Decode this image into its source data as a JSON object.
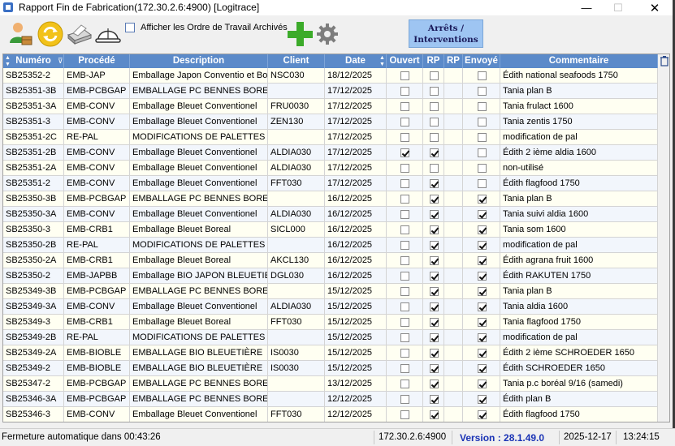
{
  "window": {
    "title": "Rapport Fin de Fabrication(172.30.2.6:4900) [Logitrace]",
    "minimize": "—",
    "maximize": "☐",
    "close": "✕"
  },
  "toolbar": {
    "icons": [
      "user-box-icon",
      "refresh-icon",
      "printer-icon",
      "hard-hat-icon",
      "add-plus-icon",
      "gear-icon"
    ],
    "archive_label": "Afficher les Ordre de Travail Archivés",
    "archive_checked": false,
    "arrets_line1": "Arrêts /",
    "arrets_line2": "Interventions"
  },
  "grid": {
    "headers": {
      "numero": "Numéro",
      "procede": "Procédé",
      "description": "Description",
      "client": "Client",
      "date": "Date",
      "ouvert": "Ouvert",
      "rp": "RP",
      "rp2": "RP",
      "envoye": "Envoyé",
      "commentaire": "Commentaire"
    },
    "rows": [
      {
        "numero": "SB25352-2",
        "procede": "EMB-JAP",
        "description": "Emballage Japon Conventio et Boré",
        "client": "NSC030",
        "date": "18/12/2025",
        "ouvert": false,
        "rp": false,
        "envoye": false,
        "commentaire": "Édith  national seafoods   1750"
      },
      {
        "numero": "SB25351-3B",
        "procede": "EMB-PCBGAP",
        "description": "EMBALLAGE PC BENNES BOREA",
        "client": "",
        "date": "17/12/2025",
        "ouvert": false,
        "rp": false,
        "envoye": false,
        "commentaire": "Tania  plan B"
      },
      {
        "numero": "SB25351-3A",
        "procede": "EMB-CONV",
        "description": "Emballage Bleuet Conventionel",
        "client": "FRU0030",
        "date": "17/12/2025",
        "ouvert": false,
        "rp": false,
        "envoye": false,
        "commentaire": "Tania frulact 1600"
      },
      {
        "numero": "SB25351-3",
        "procede": "EMB-CONV",
        "description": "Emballage Bleuet Conventionel",
        "client": "ZEN130",
        "date": "17/12/2025",
        "ouvert": false,
        "rp": false,
        "envoye": false,
        "commentaire": "Tania  zentis 1750"
      },
      {
        "numero": "SB25351-2C",
        "procede": "RE-PAL",
        "description": "MODIFICATIONS DE PALETTES",
        "client": "",
        "date": "17/12/2025",
        "ouvert": false,
        "rp": false,
        "envoye": false,
        "commentaire": "modification de pal"
      },
      {
        "numero": "SB25351-2B",
        "procede": "EMB-CONV",
        "description": "Emballage Bleuet Conventionel",
        "client": "ALDIA030",
        "date": "17/12/2025",
        "ouvert": true,
        "rp": true,
        "envoye": false,
        "commentaire": "Édith 2 ième aldia 1600"
      },
      {
        "numero": "SB25351-2A",
        "procede": "EMB-CONV",
        "description": "Emballage Bleuet Conventionel",
        "client": "ALDIA030",
        "date": "17/12/2025",
        "ouvert": false,
        "rp": false,
        "envoye": false,
        "commentaire": "non-utilisé"
      },
      {
        "numero": "SB25351-2",
        "procede": "EMB-CONV",
        "description": "Emballage Bleuet Conventionel",
        "client": "FFT030",
        "date": "17/12/2025",
        "ouvert": false,
        "rp": true,
        "envoye": false,
        "commentaire": "Édith flagfood 1750"
      },
      {
        "numero": "SB25350-3B",
        "procede": "EMB-PCBGAP",
        "description": "EMBALLAGE PC BENNES BOREA",
        "client": "",
        "date": "16/12/2025",
        "ouvert": false,
        "rp": true,
        "envoye": true,
        "commentaire": "Tania  plan B"
      },
      {
        "numero": "SB25350-3A",
        "procede": "EMB-CONV",
        "description": "Emballage Bleuet Conventionel",
        "client": "ALDIA030",
        "date": "16/12/2025",
        "ouvert": false,
        "rp": true,
        "envoye": true,
        "commentaire": "Tania suivi aldia 1600"
      },
      {
        "numero": "SB25350-3",
        "procede": "EMB-CRB1",
        "description": "Emballage Bleuet Boreal",
        "client": "SICL000",
        "date": "16/12/2025",
        "ouvert": false,
        "rp": true,
        "envoye": true,
        "commentaire": "Tania som 1600"
      },
      {
        "numero": "SB25350-2B",
        "procede": "RE-PAL",
        "description": "MODIFICATIONS DE PALETTES",
        "client": "",
        "date": "16/12/2025",
        "ouvert": false,
        "rp": true,
        "envoye": true,
        "commentaire": "modification de pal"
      },
      {
        "numero": "SB25350-2A",
        "procede": "EMB-CRB1",
        "description": "Emballage Bleuet Boreal",
        "client": "AKCL130",
        "date": "16/12/2025",
        "ouvert": false,
        "rp": true,
        "envoye": true,
        "commentaire": "Édith agrana fruit  1600"
      },
      {
        "numero": "SB25350-2",
        "procede": "EMB-JAPBB",
        "description": "Emballage BIO JAPON BLEUETIEF",
        "client": "DGL030",
        "date": "16/12/2025",
        "ouvert": false,
        "rp": true,
        "envoye": true,
        "commentaire": "Édith RAKUTEN 1750"
      },
      {
        "numero": "SB25349-3B",
        "procede": "EMB-PCBGAP",
        "description": "EMBALLAGE PC BENNES BOREA",
        "client": "",
        "date": "15/12/2025",
        "ouvert": false,
        "rp": true,
        "envoye": true,
        "commentaire": "Tania  plan B"
      },
      {
        "numero": "SB25349-3A",
        "procede": "EMB-CONV",
        "description": "Emballage Bleuet Conventionel",
        "client": "ALDIA030",
        "date": "15/12/2025",
        "ouvert": false,
        "rp": true,
        "envoye": true,
        "commentaire": "Tania aldia 1600"
      },
      {
        "numero": "SB25349-3",
        "procede": "EMB-CRB1",
        "description": "Emballage Bleuet Boreal",
        "client": "FFT030",
        "date": "15/12/2025",
        "ouvert": false,
        "rp": true,
        "envoye": true,
        "commentaire": "Tania flagfood  1750"
      },
      {
        "numero": "SB25349-2B",
        "procede": "RE-PAL",
        "description": "MODIFICATIONS DE PALETTES",
        "client": "",
        "date": "15/12/2025",
        "ouvert": false,
        "rp": true,
        "envoye": true,
        "commentaire": "modification de pal"
      },
      {
        "numero": "SB25349-2A",
        "procede": "EMB-BIOBLE",
        "description": "EMBALLAGE BIO BLEUETIÈRE",
        "client": "IS0030",
        "date": "15/12/2025",
        "ouvert": false,
        "rp": true,
        "envoye": true,
        "commentaire": "Édith 2 ième SCHROEDER 1650"
      },
      {
        "numero": "SB25349-2",
        "procede": "EMB-BIOBLE",
        "description": "EMBALLAGE BIO BLEUETIÈRE",
        "client": "IS0030",
        "date": "15/12/2025",
        "ouvert": false,
        "rp": true,
        "envoye": true,
        "commentaire": "Édith SCHROEDER 1650"
      },
      {
        "numero": "SB25347-2",
        "procede": "EMB-PCBGAP",
        "description": "EMBALLAGE PC BENNES BOREA",
        "client": "",
        "date": "13/12/2025",
        "ouvert": false,
        "rp": true,
        "envoye": true,
        "commentaire": "Tania  p.c boréal 9/16 (samedi)"
      },
      {
        "numero": "SB25346-3A",
        "procede": "EMB-PCBGAP",
        "description": "EMBALLAGE PC BENNES BOREA",
        "client": "",
        "date": "12/12/2025",
        "ouvert": false,
        "rp": true,
        "envoye": true,
        "commentaire": "Édith  plan B"
      },
      {
        "numero": "SB25346-3",
        "procede": "EMB-CONV",
        "description": "Emballage Bleuet Conventionel",
        "client": "FFT030",
        "date": "12/12/2025",
        "ouvert": false,
        "rp": true,
        "envoye": true,
        "commentaire": "Édith flagfood  1750"
      }
    ]
  },
  "status": {
    "autoclose": "Fermeture automatique dans 00:43:26",
    "server": "172.30.2.6:4900",
    "version": "Version  : 28.1.49.0",
    "date": "2025-12-17",
    "time": "13:24:15"
  },
  "colors": {
    "header_bg": "#5b8ac9",
    "row_odd": "#fffff2",
    "row_even": "#f2f6fc",
    "arrets_button": "#9ec5f2",
    "version_text": "#1a33b5"
  }
}
